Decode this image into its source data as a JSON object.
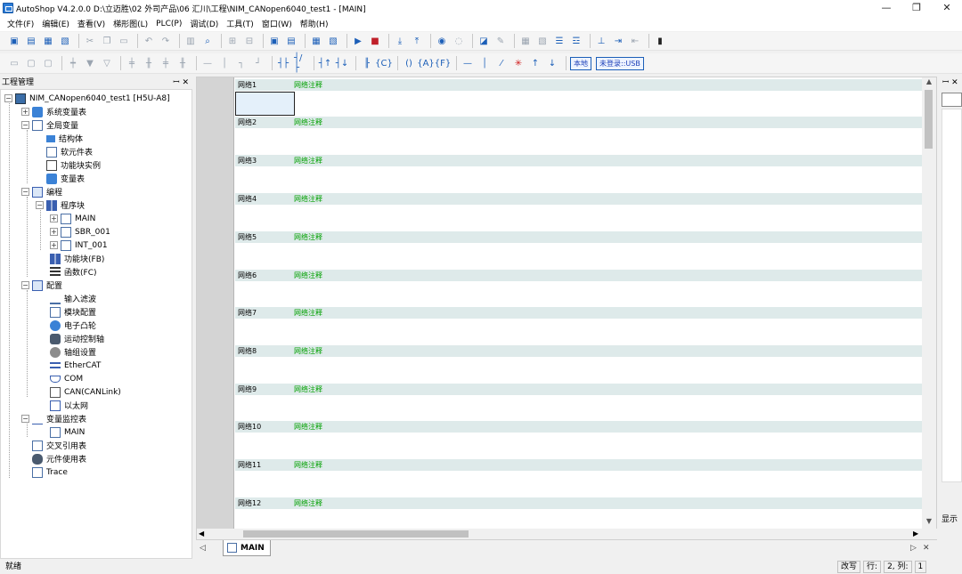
{
  "window": {
    "title": "AutoShop V4.2.0.0  D:\\立迈胜\\02 外司产品\\06 汇川\\工程\\NIM_CANopen6040_test1 - [MAIN]",
    "minimize": "—",
    "restore": "❐",
    "close": "✕"
  },
  "menu": [
    "文件(F)",
    "编辑(E)",
    "查看(V)",
    "梯形图(L)",
    "PLC(P)",
    "调试(D)",
    "工具(T)",
    "窗口(W)",
    "帮助(H)"
  ],
  "toolbar2": {
    "local_label": "本地",
    "login_label": "未登录::USB"
  },
  "project_panel": {
    "title": "工程管理",
    "pin": "ꟷ ✕",
    "root": "NIM_CANopen6040_test1 [H5U-A8]",
    "system_vars": "系统变量表",
    "global_vars": "全局变量",
    "struct": "结构体",
    "soft_elements": "软元件表",
    "fb_instances": "功能块实例",
    "var_table": "变量表",
    "programming": "编程",
    "program_blocks": "程序块",
    "main": "MAIN",
    "sbr": "SBR_001",
    "int": "INT_001",
    "fb": "功能块(FB)",
    "fc": "函数(FC)",
    "config": "配置",
    "input_filter": "输入滤波",
    "module_config": "模块配置",
    "ecam": "电子凸轮",
    "motion_axis": "运动控制轴",
    "axis_group": "轴组设置",
    "ethercat": "EtherCAT",
    "com": "COM",
    "can": "CAN(CANLink)",
    "ethernet": "以太网",
    "var_monitor": "变量监控表",
    "monitor_main": "MAIN",
    "cross_ref": "交叉引用表",
    "element_usage": "元件使用表",
    "trace": "Trace"
  },
  "networks": [
    {
      "label": "网络1",
      "comment": "网络注释"
    },
    {
      "label": "网络2",
      "comment": "网络注释"
    },
    {
      "label": "网络3",
      "comment": "网络注释"
    },
    {
      "label": "网络4",
      "comment": "网络注释"
    },
    {
      "label": "网络5",
      "comment": "网络注释"
    },
    {
      "label": "网络6",
      "comment": "网络注释"
    },
    {
      "label": "网络7",
      "comment": "网络注释"
    },
    {
      "label": "网络8",
      "comment": "网络注释"
    },
    {
      "label": "网络9",
      "comment": "网络注释"
    },
    {
      "label": "网络10",
      "comment": "网络注释"
    },
    {
      "label": "网络11",
      "comment": "网络注释"
    },
    {
      "label": "网络12",
      "comment": "网络注释"
    }
  ],
  "tab": {
    "label": "MAIN"
  },
  "right_panel": {
    "pin": "ꟷ ✕",
    "footer": "显示"
  },
  "status": {
    "left": "就绪",
    "mode": "改写",
    "row_label": "行:",
    "row_value": "2, 列:",
    "col_value": "1"
  }
}
